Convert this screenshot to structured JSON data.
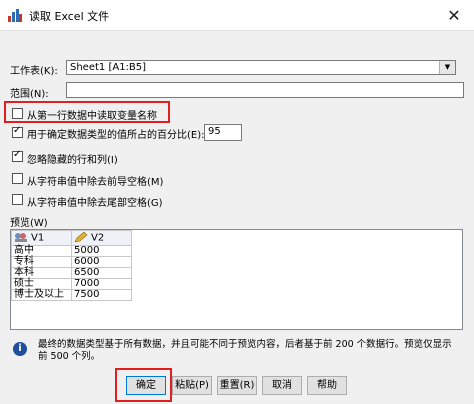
{
  "window": {
    "title": "读取 Excel 文件",
    "close_glyph": "✕"
  },
  "form": {
    "worksheet_label": "工作表(K):",
    "worksheet_value": "Sheet1 [A1:B5]",
    "range_label": "范围(N):",
    "range_value": "",
    "option_read_names": "从第一行数据中读取变量名称",
    "option_read_names_checked": false,
    "option_percent": "用于确定数据类型的值所占的百分比(E):",
    "option_percent_checked": true,
    "percent_value": "95",
    "option_ignore_hidden": "忽略隐藏的行和列(I)",
    "option_ignore_hidden_checked": true,
    "option_trim_leading": "从字符串值中除去前导空格(M)",
    "option_trim_leading_checked": false,
    "option_trim_trailing": "从字符串值中除去尾部空格(G)",
    "option_trim_trailing_checked": false
  },
  "preview": {
    "label": "预览(W)",
    "columns": [
      {
        "name": "V1",
        "icon": "nominal-string-icon"
      },
      {
        "name": "V2",
        "icon": "scale-pencil-icon"
      }
    ],
    "rows": [
      [
        "高中",
        "5000"
      ],
      [
        "专科",
        "6000"
      ],
      [
        "本科",
        "6500"
      ],
      [
        "硕士",
        "7000"
      ],
      [
        "博士及以上",
        "7500"
      ]
    ]
  },
  "info": {
    "text": "最终的数据类型基于所有数据，并且可能不同于预览内容，后者基于前 200 个数据行。预览仅显示前 500 个列。"
  },
  "buttons": {
    "ok": "确定",
    "paste": "粘贴(P)",
    "reset": "重置(R)",
    "cancel": "取消",
    "help": "帮助"
  },
  "colors": {
    "highlight": "#e02020",
    "info_icon": "#1f4e9a"
  }
}
